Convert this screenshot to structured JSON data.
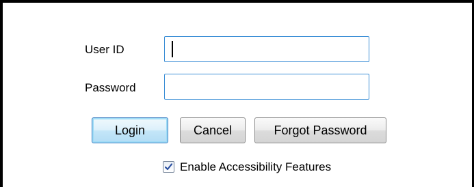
{
  "login_form": {
    "user_id_label": "User ID",
    "user_id_value": "",
    "password_label": "Password",
    "password_value": "",
    "login_button": "Login",
    "cancel_button": "Cancel",
    "forgot_password_button": "Forgot Password",
    "accessibility_checkbox": {
      "label": "Enable Accessibility Features",
      "checked": true
    }
  },
  "colors": {
    "field_border": "#3c8fd6",
    "default_button_border": "#3a7bc0",
    "frame_border": "#000000"
  }
}
